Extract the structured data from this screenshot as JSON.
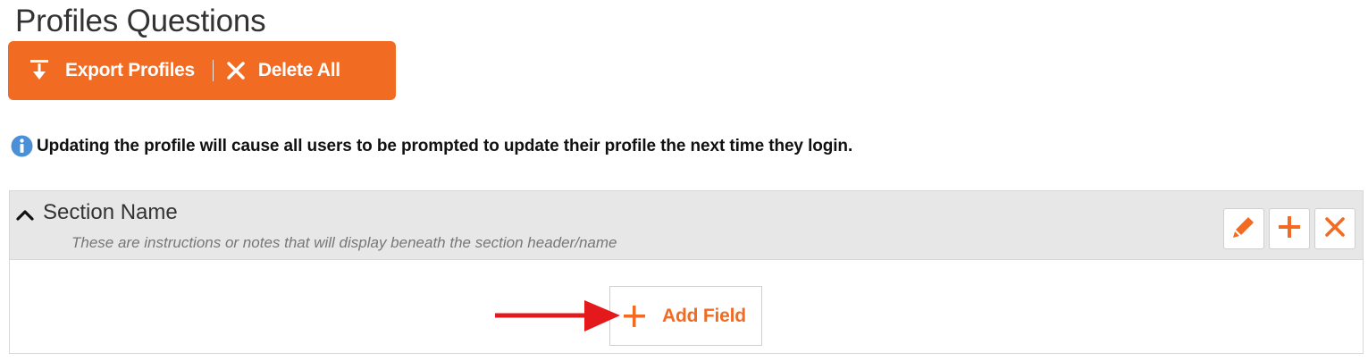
{
  "page": {
    "title": "Profiles Questions"
  },
  "toolbar": {
    "export_label": "Export Profiles",
    "export_icon": "download-icon",
    "delete_all_label": "Delete All",
    "delete_all_icon": "close-icon",
    "background_color": "#f26b22"
  },
  "notice": {
    "icon": "info-icon",
    "text": "Updating the profile will cause all users to be prompted to update their profile the next time they login."
  },
  "section": {
    "name": "Section Name",
    "notes": "These are instructions or notes that will display beneath the section header/name",
    "toggle_icon": "chevron-up-icon",
    "actions": {
      "edit_icon": "pencil-icon",
      "add_icon": "plus-icon",
      "delete_icon": "close-icon"
    },
    "add_field_label": "Add Field"
  },
  "colors": {
    "accent": "#f26b22",
    "annotation_arrow": "#e3191b",
    "info_icon": "#4a90d9"
  }
}
